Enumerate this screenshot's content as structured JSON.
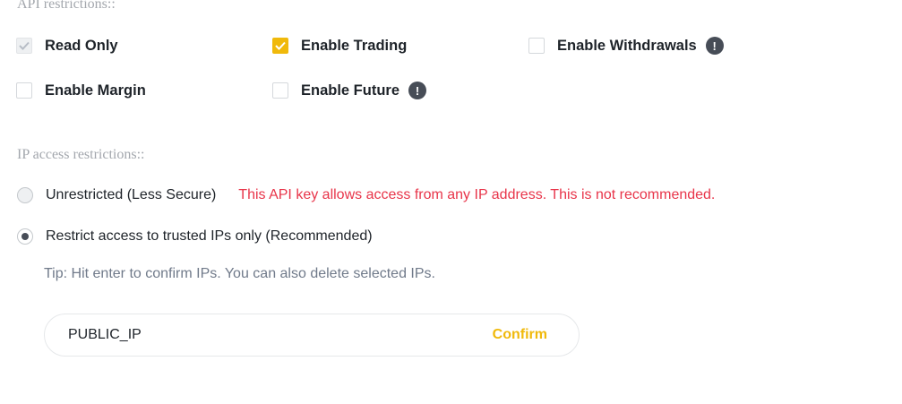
{
  "api_restrictions": {
    "title": "API restrictions::",
    "permissions": [
      {
        "label": "Read Only",
        "checked": true,
        "disabled": true,
        "info": false
      },
      {
        "label": "Enable Trading",
        "checked": true,
        "disabled": false,
        "info": false
      },
      {
        "label": "Enable Withdrawals",
        "checked": false,
        "disabled": false,
        "info": true
      },
      {
        "label": "Enable Margin",
        "checked": false,
        "disabled": false,
        "info": false
      },
      {
        "label": "Enable Future",
        "checked": false,
        "disabled": false,
        "info": true
      }
    ],
    "info_glyph": "!"
  },
  "ip_restrictions": {
    "title": "IP access restrictions::",
    "options": [
      {
        "label": "Unrestricted (Less Secure)",
        "selected": false
      },
      {
        "label": "Restrict access to trusted IPs only (Recommended)",
        "selected": true
      }
    ],
    "warning": "This API key allows access from any IP address. This is not recommended.",
    "tip": "Tip: Hit enter to confirm IPs. You can also delete selected IPs.",
    "input_value": "PUBLIC_IP",
    "confirm_label": "Confirm"
  },
  "colors": {
    "accent": "#f0b90b",
    "warning": "#e8354a",
    "text": "#1e2329",
    "muted": "#a3a7ad"
  },
  "icons": {
    "checkmark": "checkmark-icon",
    "info": "info-icon"
  }
}
